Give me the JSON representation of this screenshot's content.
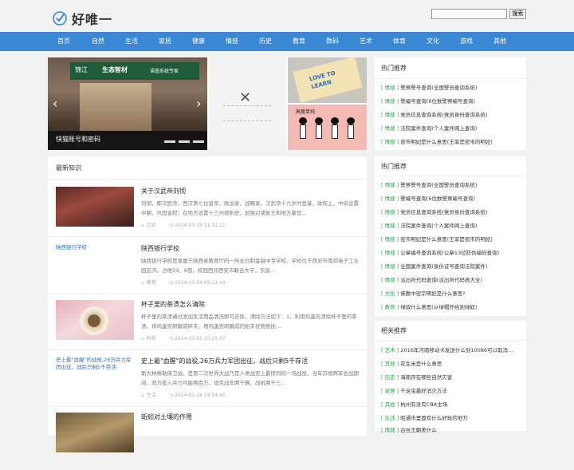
{
  "site": {
    "name": "好唯一",
    "accent": "#3a87d3"
  },
  "search": {
    "placeholder": "",
    "button": "搜索"
  },
  "nav": [
    "首页",
    "自然",
    "生活",
    "家居",
    "健康",
    "情感",
    "历史",
    "教育",
    "数码",
    "艺术",
    "体育",
    "文化",
    "游戏",
    "其他"
  ],
  "slider": {
    "caption": "快猫账号和密码",
    "main_sign": [
      "锦江",
      "生态智材",
      "诺茵系统专家"
    ],
    "tl_text": [
      "LOVE TO",
      "LEARN"
    ],
    "bl_title": "高瘦单纯"
  },
  "latest": {
    "title": "最新知识",
    "articles": [
      {
        "title": "关于汉武帝刘彻",
        "desc": "刘彻，即汉武帝，西汉第七位皇帝，政治家、战略家。汉武帝十六岁时登基，政权上，中央设置中朝，巩固皇权；在地方设置十三州部刺史，加强对诸侯王和地方豪官…",
        "tag": "历史",
        "date": "2024-03-19 11:32:21",
        "thumb_alt": ""
      },
      {
        "title": "陕西银行学校",
        "desc": "陕西银行学校是隶属于陕西省教育厅的一所全日制金融中专学校。学校位于西安市南郊电子工业园区内，占地59。8亩，校园西邻西安市联合大学，东接…",
        "tag": "教育",
        "date": "2024-03-04 09:12:44",
        "thumb_alt": "陕西银行学校"
      },
      {
        "title": "杯子里的茶渍怎么清除",
        "desc": "杯子里的茶渍通过添加生活用品清洗即可去除，清除方法如下：1、利用鸡蛋壳清除杯子里的茶渍。将鸡蛋壳研磨成碎末，用鸡蛋壳研磨成的粉末状物质插…",
        "tag": "科技",
        "date": "2024-03-01 10:25:37",
        "thumb_alt": ""
      },
      {
        "title": "史上最\"血腥\"的战役,26万兵力军团出征，战后只剩5千存活",
        "desc": "斯大林格勒保卫战，是第二次世界大战乃是人类战史上最惨烈的一场战役。当年苏德两军会战期间，双方投入兵力可能两百万，坦克战车两千辆，战机两千三…",
        "tag": "生活",
        "date": "2024-02-29 19:54:42",
        "thumb_alt": "史上最\"血腥\"的战役,26万兵力军团出征，战后只剩5千存活"
      },
      {
        "title": "蚯蚓对土壤的作用",
        "desc": "",
        "tag": "",
        "date": "",
        "thumb_alt": ""
      }
    ]
  },
  "hot1": {
    "title": "热门推荐",
    "items": [
      {
        "cat": "[ 情感 ]",
        "text": "警察警号查询(全国警员查询系统)"
      },
      {
        "cat": "[ 情感 ]",
        "text": "警编号查询(6位数警察编号查询)"
      },
      {
        "cat": "[ 情感 ]",
        "text": "党员信息查询系统(党员身份查询系统)"
      },
      {
        "cat": "[ 情感 ]",
        "text": "法院案件查询(个人案件网上查询)"
      },
      {
        "cat": "[ 情感 ]",
        "text": "密市明妃是什么意思(王菲是密市的明妃)"
      }
    ]
  },
  "hot2": {
    "title": "热门推荐",
    "items": [
      {
        "cat": "[ 情感 ]",
        "text": "警察警号查询(全国警员查询系统)"
      },
      {
        "cat": "[ 情感 ]",
        "text": "警编号查询(6位数警察编号查询)"
      },
      {
        "cat": "[ 情感 ]",
        "text": "党员信息查询系统(党员身份查询系统)"
      },
      {
        "cat": "[ 情感 ]",
        "text": "法院案件查询(个人案件网上查询)"
      },
      {
        "cat": "[ 情感 ]",
        "text": "密市明妃是什么意思(王菲是密市的明妃)"
      },
      {
        "cat": "[ 情感 ]",
        "text": "公章编号查询系统(公章13位防伪编码查询)"
      },
      {
        "cat": "[ 情感 ]",
        "text": "全国案件查询(身份证号查询法院案件)"
      },
      {
        "cat": "[ 情感 ]",
        "text": "派出所代码查询(派出所代码表大全)"
      },
      {
        "cat": "[ 文化 ]",
        "text": "佛教中密宗明妃是什么意思?"
      },
      {
        "cat": "[ 教育 ]",
        "text": "绿奴什么意思(从绿帽开始到绿奴)"
      }
    ]
  },
  "related": {
    "title": "相关推荐",
    "items": [
      {
        "cat": "[ 艺术 ]",
        "text": "2016年河南移动卡发送什么到10086可以取消…"
      },
      {
        "cat": "[ 其他 ]",
        "text": "花生米是什么意思"
      },
      {
        "cat": "[ 历史 ]",
        "text": "海南存在哪些自然灾害"
      },
      {
        "cat": "[ 家居 ]",
        "text": "千足虫最好消灭方法"
      },
      {
        "cat": "[ 其他 ]",
        "text": "杭州有没有CBA主场"
      },
      {
        "cat": "[ 生活 ]",
        "text": "昭通市里面有什么好玩的地方"
      },
      {
        "cat": "[ 情感 ]",
        "text": "古丝王朝美什么"
      }
    ]
  }
}
